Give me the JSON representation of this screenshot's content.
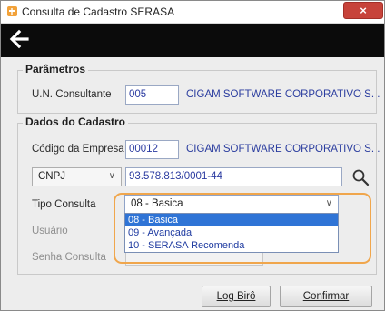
{
  "window": {
    "title": "Consulta de Cadastro SERASA",
    "close_glyph": "×"
  },
  "toolbar": {
    "back_icon": "arrow-left-icon"
  },
  "parametros": {
    "title": "Parâmetros",
    "un_label": "U.N. Consultante",
    "un_value": "005",
    "un_desc": "CIGAM SOFTWARE CORPORATIVO S. ."
  },
  "cadastro": {
    "title": "Dados do Cadastro",
    "empresa_label": "Código da Empresa",
    "empresa_value": "00012",
    "empresa_desc": "CIGAM SOFTWARE CORPORATIVO S. .",
    "doc_type": "CNPJ",
    "doc_value": "93.578.813/0001-44",
    "tipo_label": "Tipo Consulta",
    "tipo_selected": "08 - Basica",
    "tipo_options": [
      "08 - Basica",
      "09 - Avançada",
      "10 - SERASA Recomenda"
    ],
    "usuario_label": "Usuário",
    "senha_label": "Senha Consulta"
  },
  "buttons": {
    "log_biro": "Log Birô",
    "confirmar": "Confirmar"
  },
  "colors": {
    "highlight": "#f0a64c",
    "selection": "#2f74d6",
    "link_text": "#2b3d9f"
  }
}
